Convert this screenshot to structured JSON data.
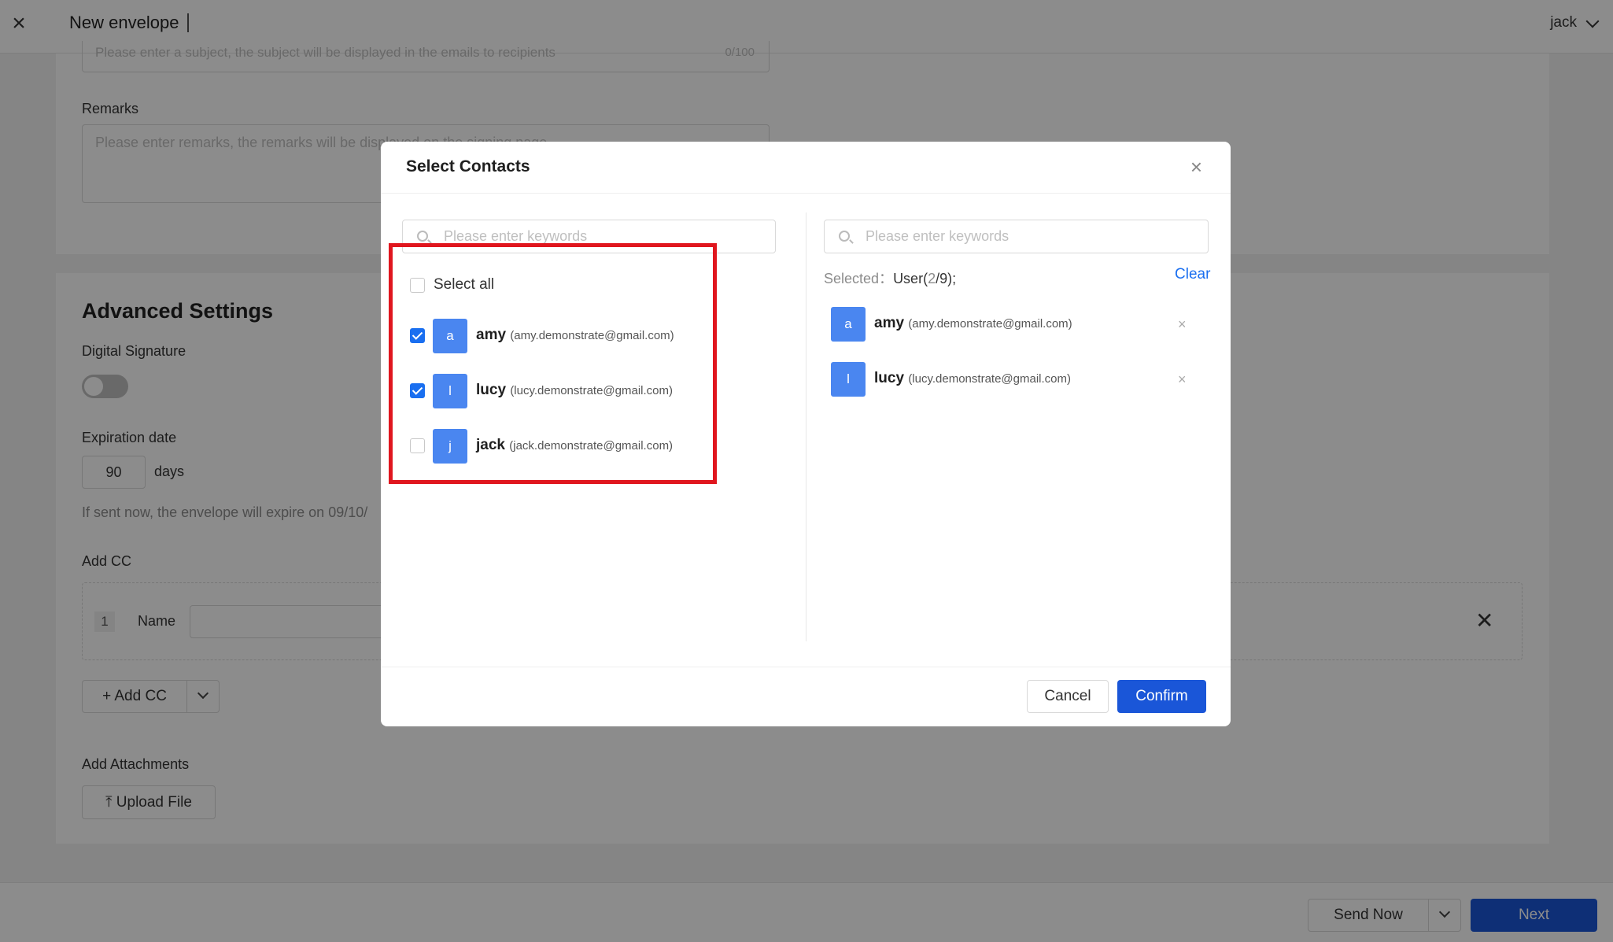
{
  "header": {
    "title": "New envelope",
    "user": "jack"
  },
  "subject": {
    "placeholder": "Please enter a subject, the subject will be displayed in the emails to recipients",
    "count": "0/100"
  },
  "remarks": {
    "label": "Remarks",
    "placeholder": "Please enter remarks, the remarks will be displayed on the signing page"
  },
  "advanced": {
    "title": "Advanced Settings",
    "digital_signature_label": "Digital Signature",
    "digital_signature_on": false,
    "expiration_label": "Expiration date",
    "expiration_value": "90",
    "expiration_unit": "days",
    "expiration_hint": "If sent now, the envelope will expire on 09/10/",
    "add_cc_label": "Add CC",
    "cc_row_index": "1",
    "cc_name_label": "Name",
    "add_cc_button": "+ Add CC",
    "attachments_label": "Add Attachments",
    "upload_button": "Upload File"
  },
  "footer": {
    "send_now": "Send Now",
    "next": "Next"
  },
  "modal": {
    "title": "Select Contacts",
    "left_search_placeholder": "Please enter keywords",
    "right_search_placeholder": "Please enter keywords",
    "select_all_label": "Select all",
    "contacts": [
      {
        "initial": "a",
        "name": "amy",
        "email": "(amy.demonstrate@gmail.com)",
        "checked": true
      },
      {
        "initial": "l",
        "name": "lucy",
        "email": "(lucy.demonstrate@gmail.com)",
        "checked": true
      },
      {
        "initial": "j",
        "name": "jack",
        "email": "(jack.demonstrate@gmail.com)",
        "checked": false
      }
    ],
    "selected_label": "Selected：",
    "selected_prefix": "User(",
    "selected_count": "2",
    "selected_suffix": "/9);",
    "clear_label": "Clear",
    "selected": [
      {
        "initial": "a",
        "name": "amy",
        "email": "(amy.demonstrate@gmail.com)"
      },
      {
        "initial": "l",
        "name": "lucy",
        "email": "(lucy.demonstrate@gmail.com)"
      }
    ],
    "cancel_label": "Cancel",
    "confirm_label": "Confirm"
  },
  "colors": {
    "primary": "#1a56d8",
    "avatar": "#4a86f0",
    "highlight": "#e0161e"
  }
}
